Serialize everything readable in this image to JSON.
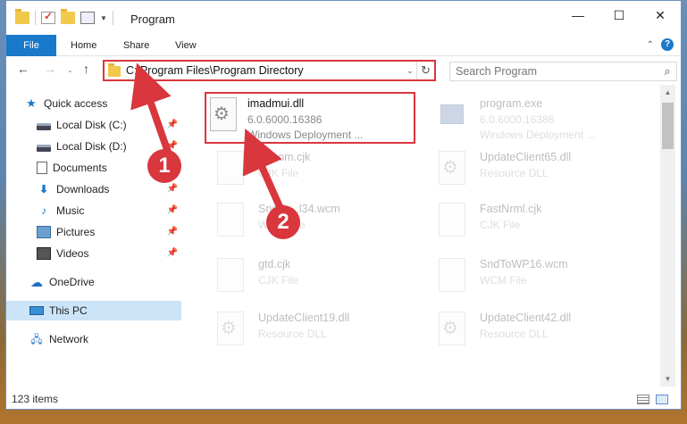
{
  "window": {
    "title": "Program",
    "minimize": "—",
    "maximize": "☐",
    "close": "✕"
  },
  "ribbon": {
    "tabs": [
      "File",
      "Home",
      "Share",
      "View"
    ],
    "help": "?",
    "collapse": "⌃"
  },
  "nav": {
    "back": "←",
    "forward": "→",
    "recent": "⌄",
    "up": "↑",
    "address": "C:\\Program Files\\Program Directory",
    "address_caret": "⌄",
    "refresh": "↻",
    "search_placeholder": "Search Program",
    "search_icon": "⌕"
  },
  "sidebar": {
    "items": [
      {
        "label": "Quick access",
        "icon": "star-icon"
      },
      {
        "label": "Local Disk (C:)",
        "icon": "drive-icon",
        "pinned": true
      },
      {
        "label": "Local Disk (D:)",
        "icon": "drive-icon",
        "pinned": true
      },
      {
        "label": "Documents",
        "icon": "documents-icon",
        "pinned": true
      },
      {
        "label": "Downloads",
        "icon": "downloads-icon",
        "pinned": true
      },
      {
        "label": "Music",
        "icon": "music-icon",
        "pinned": true
      },
      {
        "label": "Pictures",
        "icon": "pictures-icon",
        "pinned": true
      },
      {
        "label": "Videos",
        "icon": "videos-icon",
        "pinned": true
      },
      {
        "label": "OneDrive",
        "icon": "onedrive-icon"
      },
      {
        "label": "This PC",
        "icon": "pc-icon",
        "selected": true
      },
      {
        "label": "Network",
        "icon": "network-icon"
      }
    ]
  },
  "files": [
    {
      "name": "imadmui.dll",
      "line2": "6.0.6000.16386",
      "line3": "Windows Deployment ...",
      "highlighted": true
    },
    {
      "name": "program.exe",
      "line2": "6.0.6000.16386",
      "line3": "Windows Deployment ..."
    },
    {
      "name": "Bt...om.cjk",
      "line2": "CJK File"
    },
    {
      "name": "UpdateClient65.dll",
      "line2": "Resource DLL"
    },
    {
      "name": "SndTo...l34.wcm",
      "line2": "WCM File"
    },
    {
      "name": "FastNrml.cjk",
      "line2": "CJK File"
    },
    {
      "name": "gtd.cjk",
      "line2": "CJK File"
    },
    {
      "name": "SndToWP16.wcm",
      "line2": "WCM File"
    },
    {
      "name": "UpdateClient19.dll",
      "line2": "Resource DLL"
    },
    {
      "name": "UpdateClient42.dll",
      "line2": "Resource DLL"
    }
  ],
  "status": {
    "count": "123 items"
  },
  "annotations": {
    "badge1": "1",
    "badge2": "2",
    "highlight_color": "#d9363e"
  },
  "colors": {
    "accent": "#1979ca",
    "selected_bg": "#cce4f7"
  }
}
